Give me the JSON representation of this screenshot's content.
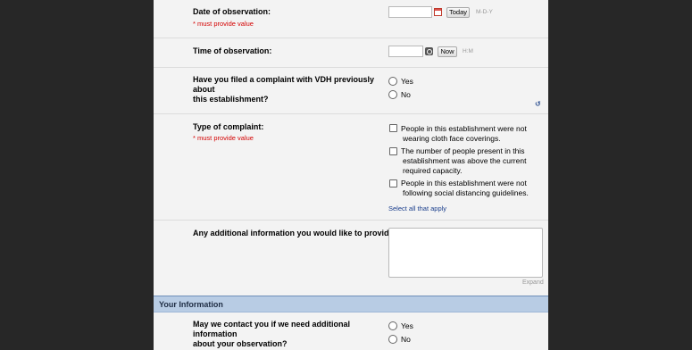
{
  "date_row": {
    "question": "Date of observation:",
    "required": "* must provide value",
    "date_value": "",
    "today_label": "Today",
    "format_hint": "M-D-Y"
  },
  "time_row": {
    "question": "Time of observation:",
    "time_value": "",
    "now_label": "Now",
    "format_hint": "H:M"
  },
  "prev_complaint_row": {
    "question_line1": "Have you filed a complaint with VDH previously about",
    "question_line2": "this establishment?",
    "options": [
      "Yes",
      "No"
    ],
    "reset_glyph": "↺"
  },
  "complaint_type_row": {
    "question": "Type of complaint:",
    "required": "* must provide value",
    "options": [
      {
        "line1": "People in this establishment were not",
        "line2": "wearing cloth face coverings.",
        "line3": ""
      },
      {
        "line1": "The number of people present in this",
        "line2": "establishment was above the current",
        "line3": "required capacity."
      },
      {
        "line1": "People in this establishment were not",
        "line2": "following social distancing guidelines.",
        "line3": ""
      }
    ],
    "select_all": "Select all that apply"
  },
  "additional_info_row": {
    "question": "Any additional information you would like to provide:",
    "text_value": "",
    "expand_label": "Expand"
  },
  "your_info_section": {
    "title": "Your Information"
  },
  "contact_row": {
    "question_line1": "May we contact you if we need additional information",
    "question_line2": "about your observation?",
    "options": [
      "Yes",
      "No"
    ]
  }
}
